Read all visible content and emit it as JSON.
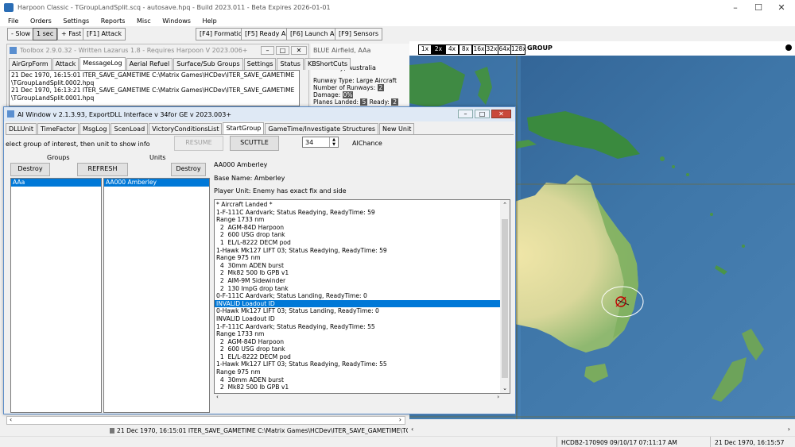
{
  "app": {
    "title": "Harpoon Classic - TGroupLandSplit.scq - autosave.hpq - Build 2023.011 - Beta Expires 2026-01-01",
    "menu": [
      "File",
      "Orders",
      "Settings",
      "Reports",
      "Misc",
      "Windows",
      "Help"
    ],
    "toolbar": [
      "- Slow",
      "1 sec",
      "+ Fast",
      "[F1] Attack",
      "[F4] Formation",
      "[F5] Ready Air",
      "[F6] Launch Air",
      "[F9] Sensors"
    ]
  },
  "map": {
    "zoom": [
      "1x",
      "2x",
      "4x",
      "8x",
      "16x",
      "32x",
      "64x",
      "128x"
    ],
    "zoom_selected": "2x",
    "mode_label": "GROUP"
  },
  "toolbox": {
    "title": "Toolbox 2.9.0.32 - Written Lazarus 1.8 - Requires Harpoon V 2023.006+",
    "tabs": [
      "AirGrpForm",
      "Attack",
      "MessageLog",
      "Aerial Refuel",
      "Surface/Sub Groups",
      "Settings",
      "Status",
      "KBShortCuts"
    ],
    "active_tab": "MessageLog",
    "log": [
      "21 Dec 1970, 16:15:01  ITER_SAVE_GAMETIME C:\\Matrix Games\\HCDev\\ITER_SAVE_GAMETIME",
      "\\TGroupLandSplit.0002.hpq",
      "21 Dec 1970, 16:13:21  ITER_SAVE_GAMETIME C:\\Matrix Games\\HCDev\\ITER_SAVE_GAMETIME",
      "\\TGroupLandSplit.0001.hpq"
    ]
  },
  "info_panel": {
    "title": "BLUE Airfield, AAa",
    "location": "Amberley, Australia",
    "runway_type": "Runway Type: Large Aircraft",
    "runways_label": "Number of Runways:",
    "runways_value": "2",
    "damage_label": "Damage:",
    "damage_value": "0%",
    "planes_landed_label": "Planes Landed:",
    "planes_landed_value": "5",
    "ready_label": "Ready:",
    "ready_value": "2"
  },
  "ai_window": {
    "title": "AI Window v 2.1.3.93, ExportDLL Interface v 34for GE v 2023.003+",
    "tabs": [
      "DLLUnit",
      "TimeFactor",
      "MsgLog",
      "ScenLoad",
      "VictoryConditionsList",
      "StartGroup",
      "GameTime/Investigate Structures",
      "New Unit"
    ],
    "active_tab": "StartGroup",
    "instructions": "elect group of interest, then unit to show info",
    "resume_label": "RESUME",
    "scuttle_label": "SCUTTLE",
    "spin_value": "34",
    "aichance_label": "AIChance",
    "groups_header": "Groups",
    "units_header": "Units",
    "destroy_label": "Destroy",
    "refresh_label": "REFRESH",
    "groups": [
      "AAa"
    ],
    "units": [
      "AA000 Amberley"
    ],
    "unit_name": "AA000 Amberley",
    "base_name": "Base Name: Amberley",
    "player_unit": "Player Unit: Enemy has exact fix and side",
    "details": [
      "* Aircraft Landed *",
      "1-F-111C Aardvark; Status Readying, ReadyTime: 59",
      "Range 1733 nm",
      "  2  AGM-84D Harpoon",
      "  2  600 USG drop tank",
      "  1  EL/L-8222 DECM pod",
      "1-Hawk Mk127 LIFT 03; Status Readying, ReadyTime: 59",
      "Range 975 nm",
      "  4  30mm ADEN burst",
      "  2  Mk82 500 lb GPB v1",
      "  2  AIM-9M Sidewinder",
      "  2  130 ImpG drop tank",
      "0-F-111C Aardvark; Status Landing, ReadyTime: 0",
      "INVALID Loadout ID",
      "0-Hawk Mk127 LIFT 03; Status Landing, ReadyTime: 0",
      "INVALID Loadout ID",
      "1-F-111C Aardvark; Status Readying, ReadyTime: 55",
      "Range 1733 nm",
      "  2  AGM-84D Harpoon",
      "  2  600 USG drop tank",
      "  1  EL/L-8222 DECM pod",
      "1-Hawk Mk127 LIFT 03; Status Readying, ReadyTime: 55",
      "Range 975 nm",
      "  4  30mm ADEN burst",
      "  2  Mk82 500 lb GPB v1"
    ],
    "selected_detail_index": 13
  },
  "status_bar": {
    "message": "21 Dec 1970, 16:15:01  ITER_SAVE_GAMETIME C:\\Matrix Games\\HCDev\\ITER_SAVE_GAMETIME\\TGroupLandS",
    "build": "HCDB2-170909 09/10/17 07:11:17 AM",
    "game_time": "21 Dec 1970, 16:15:57"
  }
}
